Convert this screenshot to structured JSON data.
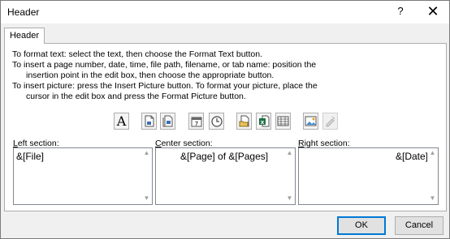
{
  "window": {
    "title": "Header",
    "help_label": "?",
    "close_label": "✕"
  },
  "tab": {
    "label": "Header"
  },
  "instructions": [
    "To format text:  select the text, then choose the Format Text button.",
    "To insert a page number, date, time, file path, filename, or tab name:  position the",
    "insertion point in the edit box, then choose the appropriate button.",
    "To insert picture: press the Insert Picture button.  To format your picture, place the",
    "cursor in the edit box and press the Format Picture button."
  ],
  "toolbar": {
    "buttons": [
      {
        "name": "format-text-button",
        "icon": "format-text-icon",
        "glyph": "A",
        "enabled": true
      },
      {
        "name": "insert-page-number-button",
        "icon": "page-number-icon",
        "enabled": true
      },
      {
        "name": "insert-number-of-pages-button",
        "icon": "number-of-pages-icon",
        "enabled": true
      },
      {
        "name": "insert-date-button",
        "icon": "calendar-icon",
        "glyph": "7",
        "enabled": true
      },
      {
        "name": "insert-time-button",
        "icon": "clock-icon",
        "enabled": true
      },
      {
        "name": "insert-file-path-button",
        "icon": "folder-path-icon",
        "enabled": true
      },
      {
        "name": "insert-file-name-button",
        "icon": "excel-file-icon",
        "enabled": true
      },
      {
        "name": "insert-sheet-name-button",
        "icon": "sheet-grid-icon",
        "enabled": true
      },
      {
        "name": "insert-picture-button",
        "icon": "picture-icon",
        "enabled": true
      },
      {
        "name": "format-picture-button",
        "icon": "format-picture-icon",
        "enabled": false
      }
    ]
  },
  "sections": {
    "left": {
      "label_key": "L",
      "label_rest": "eft section:",
      "value": "&[File]"
    },
    "center": {
      "label_key": "C",
      "label_rest": "enter section:",
      "value": "&[Page] of &[Pages]"
    },
    "right": {
      "label_key": "R",
      "label_rest": "ight section:",
      "value": "&[Date]"
    }
  },
  "buttons": {
    "ok_label": "OK",
    "cancel_label": "Cancel"
  },
  "colors": {
    "focus_accent": "#0078d7",
    "excel_green": "#1e7145"
  }
}
